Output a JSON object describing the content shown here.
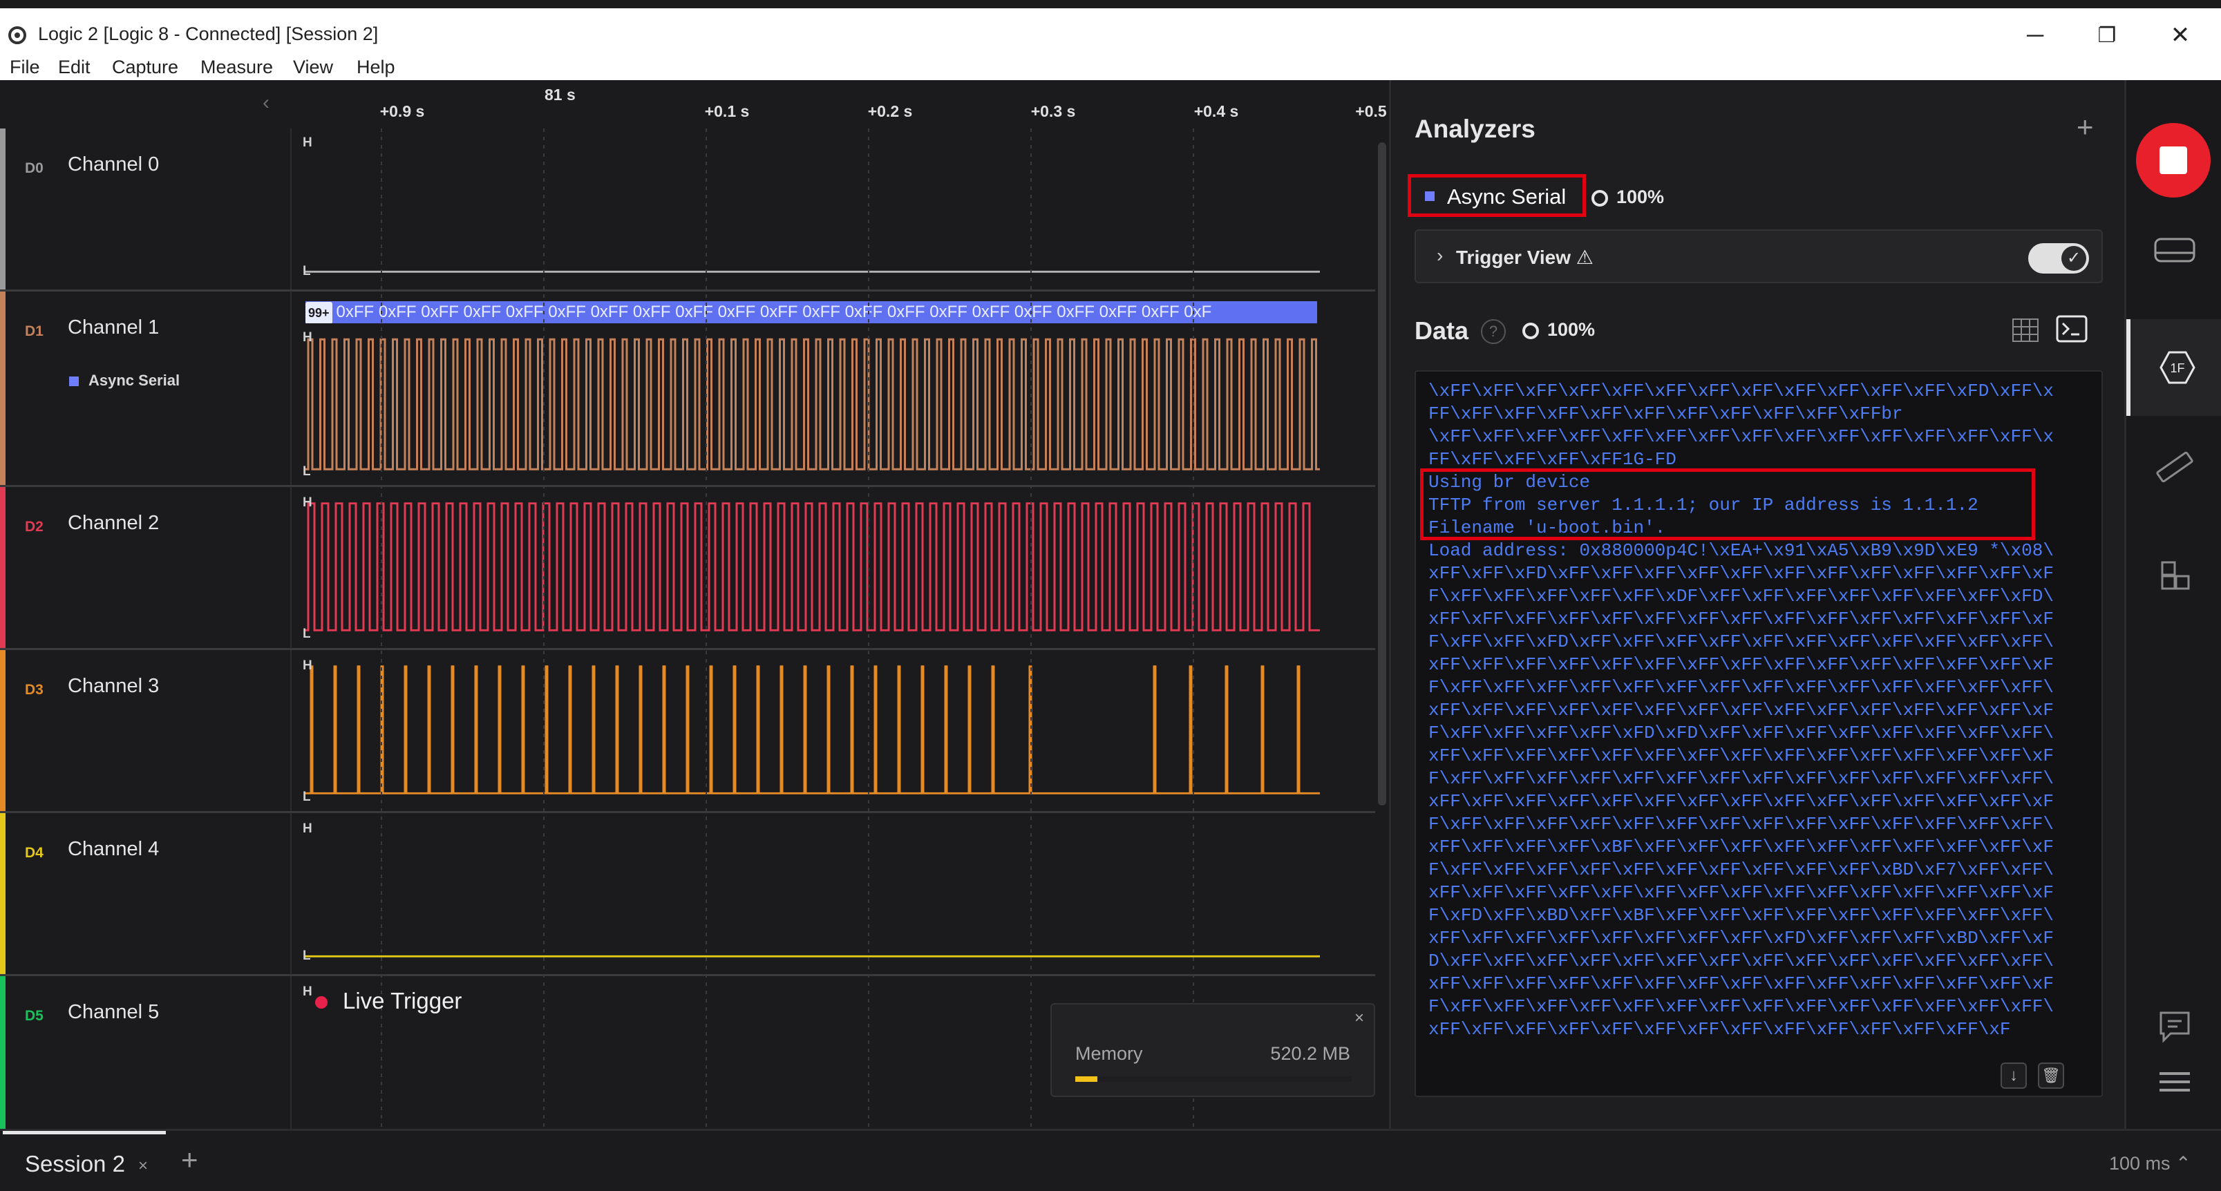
{
  "window": {
    "title": "Logic 2 [Logic 8 - Connected] [Session 2]",
    "controls": {
      "minimize": "─",
      "restore": "❐",
      "close": "✕"
    }
  },
  "menu": [
    "File",
    "Edit",
    "Capture",
    "Measure",
    "View",
    "Help"
  ],
  "timeline": {
    "anchor": "81 s",
    "ticks": [
      "+0.9 s",
      "+0.1 s",
      "+0.2 s",
      "+0.3 s",
      "+0.4 s",
      "+0.5"
    ]
  },
  "channels": [
    {
      "tag": "D0",
      "name": "Channel 0",
      "color": "#9a9a9a"
    },
    {
      "tag": "D1",
      "name": "Channel 1",
      "color": "#c5825a",
      "analyzer": "Async Serial"
    },
    {
      "tag": "D2",
      "name": "Channel 2",
      "color": "#e23a52"
    },
    {
      "tag": "D3",
      "name": "Channel 3",
      "color": "#e68a26"
    },
    {
      "tag": "D4",
      "name": "Channel 4",
      "color": "#e3c719"
    },
    {
      "tag": "D5",
      "name": "Channel 5",
      "color": "#18c25a"
    }
  ],
  "levels": {
    "high": "H",
    "low": "L"
  },
  "decode_bubbles": {
    "count_badge": "99+",
    "text": "0xFF 0xFF 0xFF 0xFF 0xFF 0xFF 0xFF 0xFF 0xFF 0xFF 0xFF 0xFF 0xFF 0xFF 0xFF 0xFF 0xFF 0xFF 0xFF 0xFF 0xF"
  },
  "live_trigger": "Live Trigger",
  "memory": {
    "label": "Memory",
    "value": "520.2 MB",
    "close": "×",
    "fill_fraction": 0.08
  },
  "analyzers": {
    "title": "Analyzers",
    "add": "+",
    "item": {
      "name": "Async Serial",
      "progress": "100%"
    },
    "trigger_view": "Trigger View ⚠"
  },
  "data": {
    "title": "Data",
    "help": "?",
    "progress": "100%",
    "lines": [
      "\\xFF\\xFF\\xFF\\xFF\\xFF\\xFF\\xFF\\xFF\\xFF\\xFF\\xFF\\xFF\\xFD\\xFF\\x",
      "FF\\xFF\\xFF\\xFF\\xFF\\xFF\\xFF\\xFF\\xFF\\xFF\\xFFbr",
      "\\xFF\\xFF\\xFF\\xFF\\xFF\\xFF\\xFF\\xFF\\xFF\\xFF\\xFF\\xFF\\xFF\\xFF\\x",
      "FF\\xFF\\xFF\\xFF\\xFF1G-FD",
      "Using br device",
      "TFTP from server 1.1.1.1; our IP address is 1.1.1.2",
      "Filename 'u-boot.bin'.",
      "Load address: 0x880000p4C!\\xEA+\\x91\\xA5\\xB9\\x9D\\xE9 *\\x08\\",
      "xFF\\xFF\\xFD\\xFF\\xFF\\xFF\\xFF\\xFF\\xFF\\xFF\\xFF\\xFF\\xFF\\xFF\\xF",
      "F\\xFF\\xFF\\xFF\\xFF\\xFF\\xDF\\xFF\\xFF\\xFF\\xFF\\xFF\\xFF\\xFF\\xFD\\",
      "xFF\\xFF\\xFF\\xFF\\xFF\\xFF\\xFF\\xFF\\xFF\\xFF\\xFF\\xFF\\xFF\\xFF\\xF",
      "F\\xFF\\xFF\\xFD\\xFF\\xFF\\xFF\\xFF\\xFF\\xFF\\xFF\\xFF\\xFF\\xFF\\xFF\\",
      "xFF\\xFF\\xFF\\xFF\\xFF\\xFF\\xFF\\xFF\\xFF\\xFF\\xFF\\xFF\\xFF\\xFF\\xF",
      "F\\xFF\\xFF\\xFF\\xFF\\xFF\\xFF\\xFF\\xFF\\xFF\\xFF\\xFF\\xFF\\xFF\\xFF\\",
      "xFF\\xFF\\xFF\\xFF\\xFF\\xFF\\xFF\\xFF\\xFF\\xFF\\xFF\\xFF\\xFF\\xFF\\xF",
      "F\\xFF\\xFF\\xFF\\xFF\\xFD\\xFD\\xFF\\xFF\\xFF\\xFF\\xFF\\xFF\\xFF\\xFF\\",
      "xFF\\xFF\\xFF\\xFF\\xFF\\xFF\\xFF\\xFF\\xFF\\xFF\\xFF\\xFF\\xFF\\xFF\\xF",
      "F\\xFF\\xFF\\xFF\\xFF\\xFF\\xFF\\xFF\\xFF\\xFF\\xFF\\xFF\\xFF\\xFF\\xFF\\",
      "xFF\\xFF\\xFF\\xFF\\xFF\\xFF\\xFF\\xFF\\xFF\\xFF\\xFF\\xFF\\xFF\\xFF\\xF",
      "F\\xFF\\xFF\\xFF\\xFF\\xFF\\xFF\\xFF\\xFF\\xFF\\xFF\\xFF\\xFF\\xFF\\xFF\\",
      "xFF\\xFF\\xFF\\xFF\\xBF\\xFF\\xFF\\xFF\\xFF\\xFF\\xFF\\xFF\\xFF\\xFF\\xF",
      "F\\xFF\\xFF\\xFF\\xFF\\xFF\\xFF\\xFF\\xFF\\xFF\\xFF\\xBD\\xF7\\xFF\\xFF\\",
      "xFF\\xFF\\xFF\\xFF\\xFF\\xFF\\xFF\\xFF\\xFF\\xFF\\xFF\\xFF\\xFF\\xFF\\xF",
      "F\\xFD\\xFF\\xBD\\xFF\\xBF\\xFF\\xFF\\xFF\\xFF\\xFF\\xFF\\xFF\\xFF\\xFF\\",
      "xFF\\xFF\\xFF\\xFF\\xFF\\xFF\\xFF\\xFF\\xFD\\xFF\\xFF\\xFF\\xBD\\xFF\\xF",
      "D\\xFF\\xFF\\xFF\\xFF\\xFF\\xFF\\xFF\\xFF\\xFF\\xFF\\xFF\\xFF\\xFF\\xFF\\",
      "xFF\\xFF\\xFF\\xFF\\xFF\\xFF\\xFF\\xFF\\xFF\\xFF\\xFF\\xFF\\xFF\\xFF\\xF",
      "F\\xFF\\xFF\\xFF\\xFF\\xFF\\xFF\\xFF\\xFF\\xFF\\xFF\\xFF\\xFF\\xFF\\xFF\\",
      "xFF\\xFF\\xFF\\xFF\\xFF\\xFF\\xFF\\xFF\\xFF\\xFF\\xFF\\xFF\\xFF\\xF"
    ],
    "scroll_down": "↓",
    "clear": "🗑"
  },
  "session": {
    "tab": "Session 2",
    "close": "×",
    "add": "+"
  },
  "timescale": "100 ms ⌃"
}
